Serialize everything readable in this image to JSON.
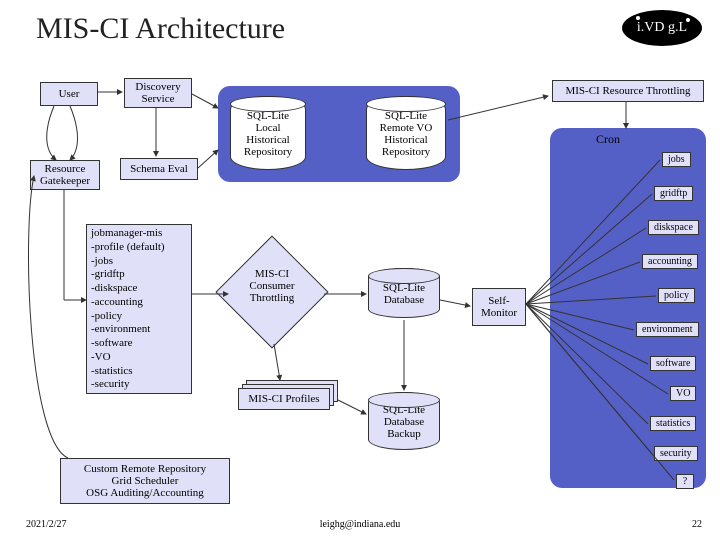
{
  "title": "MIS-CI Architecture",
  "logo_text": "i.VD g.L",
  "boxes": {
    "user": "User",
    "discovery": "Discovery\nService",
    "schema": "Schema Eval",
    "gatekeeper": "Resource\nGatekeeper",
    "miscithrottle": "MIS-CI Resource Throttling",
    "custom": "Custom Remote Repository\nGrid Scheduler\nOSG Auditing/Accounting",
    "selfmon": "Self-\nMonitor"
  },
  "cyls": {
    "local": "SQL-Lite\nLocal\nHistorical\nRepository",
    "remote": "SQL-Lite\nRemote VO\nHistorical\nRepository",
    "db": "SQL-Lite\nDatabase",
    "backup": "SQL-Lite\nDatabase\nBackup"
  },
  "diamond": "MIS-CI\nConsumer\nThrottling",
  "profiles_label": "MIS-CI Profiles",
  "jobmanager_note": "jobmanager-mis\n-profile (default)\n-jobs\n-gridftp\n-diskspace\n-accounting\n-policy\n-environment\n-software\n-VO\n-statistics\n-security",
  "cron_label": "Cron",
  "tags": [
    "jobs",
    "gridftp",
    "diskspace",
    "accounting",
    "policy",
    "environment",
    "software",
    "VO",
    "statistics",
    "security",
    "?"
  ],
  "footer": {
    "date": "2021/2/27",
    "email": "leighg@indiana.edu",
    "page": "22"
  }
}
